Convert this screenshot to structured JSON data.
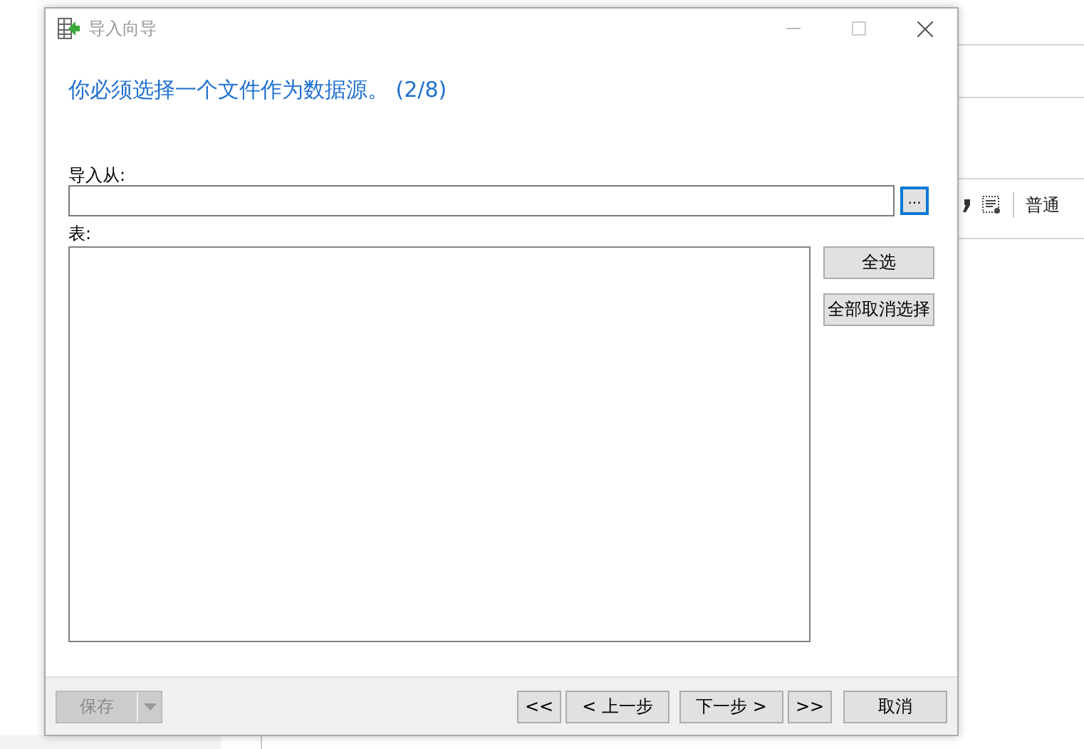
{
  "background_app": {
    "toolbar": {
      "style_label": "普通"
    }
  },
  "window": {
    "title": "导入向导"
  },
  "heading": "你必须选择一个文件作为数据源。 (2/8)",
  "import_from": {
    "label": "导入从:",
    "browse_button": "..."
  },
  "table": {
    "label": "表:"
  },
  "side_buttons": [
    {
      "label": "全选"
    },
    {
      "label": "全部取消选择"
    }
  ],
  "footer": {
    "save_button": {
      "label": "保存",
      "disabled": true
    },
    "nav_buttons": [
      {
        "label": "<<"
      },
      {
        "label": "< 上一步"
      },
      {
        "label": "下一步 >"
      },
      {
        "label": ">>"
      }
    ],
    "cancel_button": "取消"
  }
}
